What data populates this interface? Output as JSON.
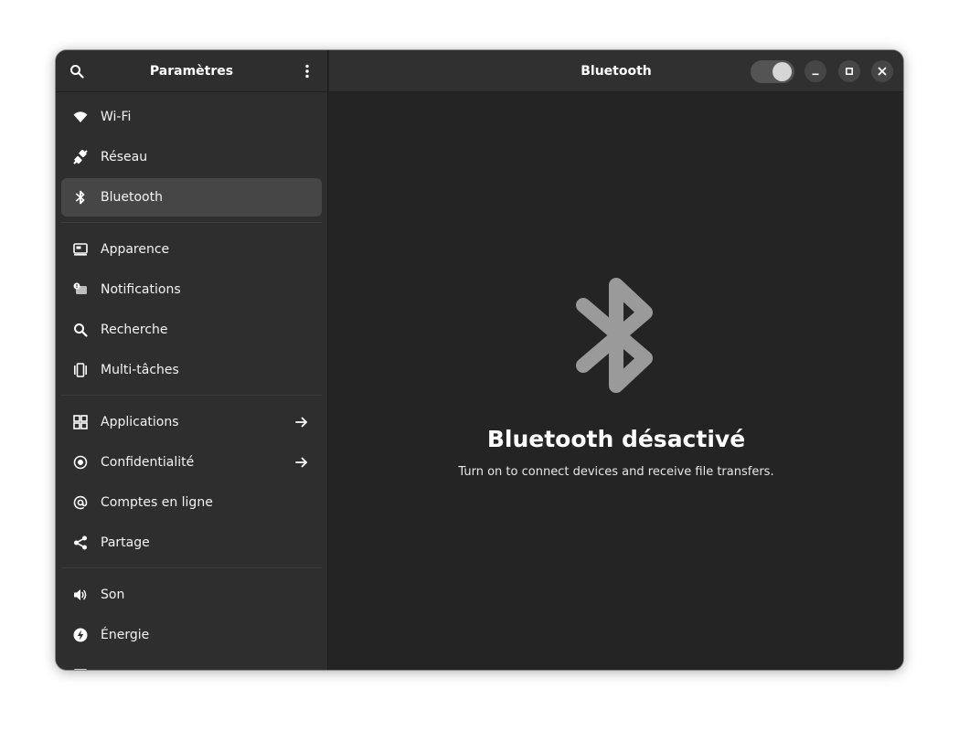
{
  "sidebar": {
    "title": "Paramètres",
    "items": [
      {
        "label": "Wi-Fi",
        "icon": "wifi-icon"
      },
      {
        "label": "Réseau",
        "icon": "network-icon"
      },
      {
        "label": "Bluetooth",
        "icon": "bluetooth-icon",
        "selected": true
      },
      {
        "label": "Apparence",
        "icon": "appearance-icon"
      },
      {
        "label": "Notifications",
        "icon": "notifications-icon"
      },
      {
        "label": "Recherche",
        "icon": "search-icon"
      },
      {
        "label": "Multi-tâches",
        "icon": "multitasking-icon"
      },
      {
        "label": "Applications",
        "icon": "applications-icon",
        "has_arrow": true
      },
      {
        "label": "Confidentialité",
        "icon": "privacy-icon",
        "has_arrow": true
      },
      {
        "label": "Comptes en ligne",
        "icon": "online-accounts-icon"
      },
      {
        "label": "Partage",
        "icon": "share-icon"
      },
      {
        "label": "Son",
        "icon": "speaker-icon"
      },
      {
        "label": "Énergie",
        "icon": "power-icon"
      }
    ]
  },
  "content": {
    "title": "Bluetooth",
    "toggle_on": false
  },
  "status": {
    "title": "Bluetooth désactivé",
    "description": "Turn on to connect devices and receive file transfers."
  },
  "colors": {
    "sidebar_bg": "#2e2e2e",
    "content_bg": "#242424",
    "selected_bg": "#464646",
    "status_icon": "#9a9a9a"
  }
}
